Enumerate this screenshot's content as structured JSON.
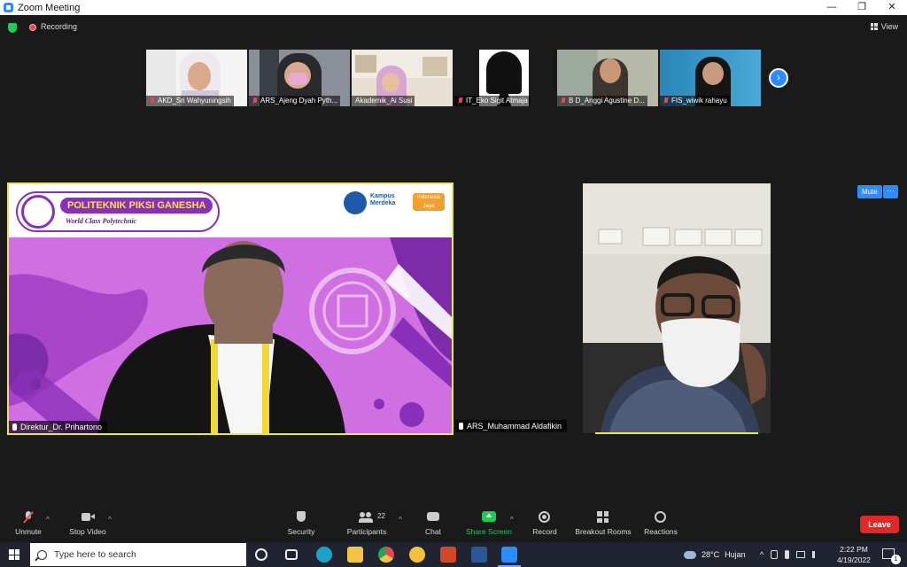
{
  "window": {
    "title": "Zoom Meeting",
    "minimize": "—",
    "restore": "❐",
    "close": "✕"
  },
  "infobar": {
    "recording_label": "Recording",
    "view_label": "View"
  },
  "thumbnails": [
    {
      "name": "AKD_Sri Wahyuningsih",
      "muted": true
    },
    {
      "name": "ARS_Ajeng Dyah Pyth...",
      "muted": true
    },
    {
      "name": "Akademik_Ai Susi",
      "muted": false
    },
    {
      "name": "IT_Eko Sigit Atmaja",
      "muted": true
    },
    {
      "name": "B D_Anggi Agustine D...",
      "muted": true
    },
    {
      "name": "FIS_wiwik rahayu",
      "muted": true
    }
  ],
  "thumbnails_next": "›",
  "main_video": {
    "name": "Direktur_Dr. Prihartono",
    "brand_title": "POLITEKNIK PIKSI GANESHA",
    "brand_tagline": "World Class Polytechnic",
    "partner_1": "Kampus Merdeka",
    "partner_2": "Indonesia Jaya",
    "seal_text": "POLITEKNIK PIKSI GANESHA"
  },
  "second_video": {
    "name": "ARS_Muhammad Aldafikin",
    "mute_label": "Mute",
    "more_label": "···"
  },
  "toolbar": {
    "unmute": "Unmute",
    "stop_video": "Stop Video",
    "security": "Security",
    "participants": "Participants",
    "participants_count": "22",
    "chat": "Chat",
    "share_screen": "Share Screen",
    "record": "Record",
    "breakout_rooms": "Breakout Rooms",
    "reactions": "Reactions",
    "leave": "Leave",
    "caret": "^"
  },
  "taskbar": {
    "search_placeholder": "Type here to search",
    "weather_temp": "28°C",
    "weather_label": "Hujan",
    "time": "2:22 PM",
    "date": "4/19/2022",
    "notif_count": "1"
  },
  "colors": {
    "zoom_blue": "#2d8cff",
    "leave_red": "#e02828",
    "active_speaker": "#e6e65a",
    "share_green": "#23c85a"
  }
}
